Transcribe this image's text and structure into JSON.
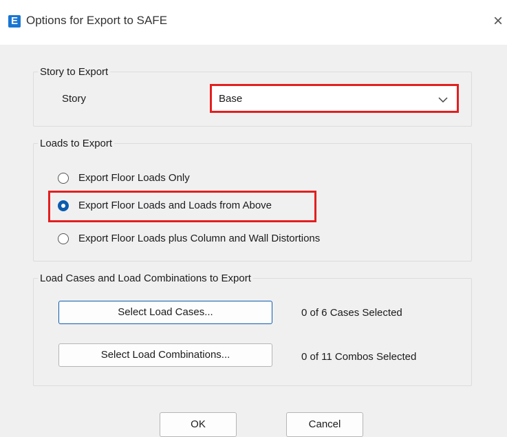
{
  "window": {
    "title": "Options for Export to SAFE",
    "app_icon_letter": "E",
    "close_symbol": "×"
  },
  "story_group": {
    "legend": "Story to Export",
    "story_label": "Story",
    "story_value": "Base"
  },
  "loads_group": {
    "legend": "Loads to Export",
    "options": [
      {
        "label": "Export Floor Loads Only",
        "selected": false
      },
      {
        "label": "Export Floor Loads and Loads from Above",
        "selected": true
      },
      {
        "label": "Export Floor Loads plus Column and Wall Distortions",
        "selected": false
      }
    ]
  },
  "cases_group": {
    "legend": "Load Cases and Load Combinations to Export",
    "select_cases_label": "Select Load Cases...",
    "cases_status": "0 of 6 Cases Selected",
    "select_combos_label": "Select Load Combinations...",
    "combos_status": "0 of 11 Combos Selected"
  },
  "footer": {
    "ok_label": "OK",
    "cancel_label": "Cancel"
  },
  "colors": {
    "highlight": "#e41e1e",
    "accent": "#0b5cad"
  }
}
